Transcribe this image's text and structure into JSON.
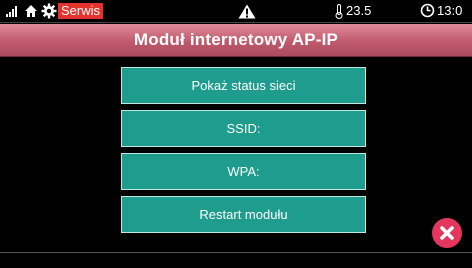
{
  "statusbar": {
    "mode_badge": "Serwis",
    "temperature": "23.5",
    "time": "13:0",
    "icons": [
      "signal-icon",
      "home-icon",
      "gear-icon",
      "alarm-warning-icon",
      "thermometer-icon",
      "clock-icon"
    ]
  },
  "title": "Moduł internetowy AP-IP",
  "menu": {
    "items": [
      {
        "label": "Pokaż status sieci"
      },
      {
        "label": "SSID:"
      },
      {
        "label": "WPA:"
      },
      {
        "label": "Restart modułu"
      }
    ]
  },
  "close_icon": "close-icon",
  "colors": {
    "title_bar": "#c05a6e",
    "button": "#1e9c8d",
    "close": "#e5365d",
    "badge": "#e6322d"
  }
}
